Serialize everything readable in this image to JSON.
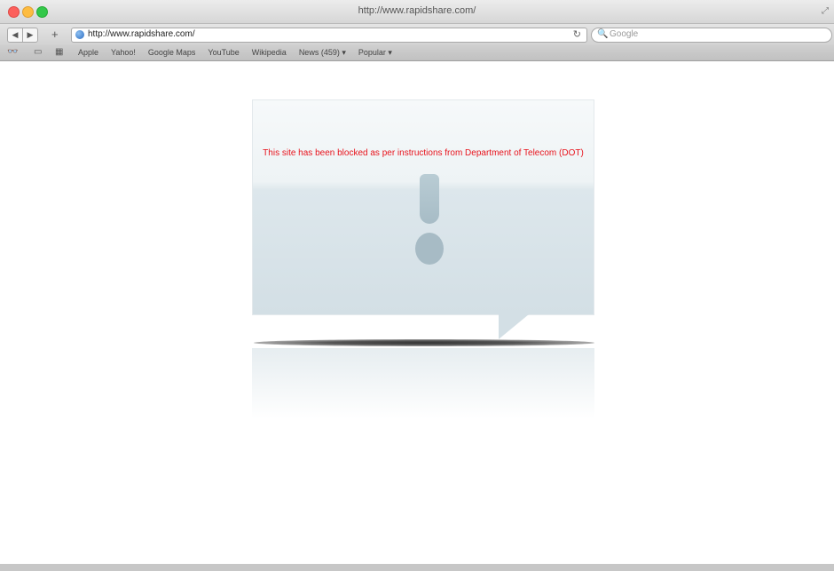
{
  "window": {
    "title": "http://www.rapidshare.com/"
  },
  "toolbar": {
    "back_label": "◀",
    "forward_label": "▶",
    "add_label": "+",
    "url": "http://www.rapidshare.com/",
    "search_placeholder": "Google",
    "reload_icon": "reload-icon"
  },
  "bookmarks": {
    "items": [
      {
        "label": "Apple"
      },
      {
        "label": "Yahoo!"
      },
      {
        "label": "Google Maps"
      },
      {
        "label": "YouTube"
      },
      {
        "label": "Wikipedia"
      },
      {
        "label": "News (459) ▾"
      },
      {
        "label": "Popular ▾"
      }
    ]
  },
  "page": {
    "message": "This site has been blocked as per instructions from Department of Telecom (DOT)"
  },
  "colors": {
    "message": "#e8141c",
    "bubble": "#d3dfe5",
    "exclamation": "#a7bbc5"
  }
}
